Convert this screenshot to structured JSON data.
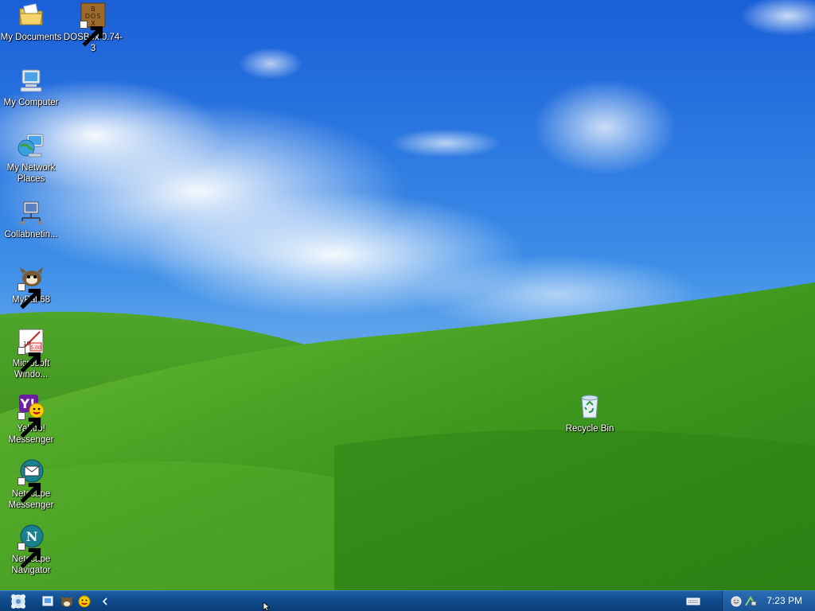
{
  "desktop": {
    "icons": [
      {
        "label": "My Documents",
        "icon": "folder-documents-icon"
      },
      {
        "label": "DOSBox 0.74-3",
        "icon": "dosbox-icon",
        "shortcut": true
      },
      {
        "label": "My Computer",
        "icon": "computer-icon"
      },
      {
        "label": "My Network Places",
        "icon": "network-places-icon"
      },
      {
        "label": "Collabnetin...",
        "icon": "network-setup-icon"
      },
      {
        "label": "MyPal 68",
        "icon": "mypal-icon",
        "shortcut": true
      },
      {
        "label": "Microsoft Windo...",
        "icon": "movie-maker-icon",
        "shortcut": true
      },
      {
        "label": "Yahoo! Messenger",
        "icon": "yahoo-messenger-icon",
        "shortcut": true
      },
      {
        "label": "Netscape Messenger",
        "icon": "netscape-messenger-icon",
        "shortcut": true
      },
      {
        "label": "Netscape Navigator",
        "icon": "netscape-navigator-icon",
        "shortcut": true
      },
      {
        "label": "Recycle Bin",
        "icon": "recycle-bin-icon"
      }
    ]
  },
  "taskbar": {
    "start_icon": "start-menu-icon",
    "quick_launch": [
      "show-desktop-icon",
      "mypal-icon",
      "yahoo-messenger-icon"
    ],
    "collapse_icon": "chevron-left-icon",
    "tray_icons": [
      "keyboard-icon",
      "messenger-status-icon",
      "network-icon"
    ],
    "clock": "7:23 PM"
  },
  "colors": {
    "taskbar": "#0f4a8a",
    "tray": "#1a5597",
    "sky": "#2a6fd4",
    "grass": "#3f9a1f"
  }
}
